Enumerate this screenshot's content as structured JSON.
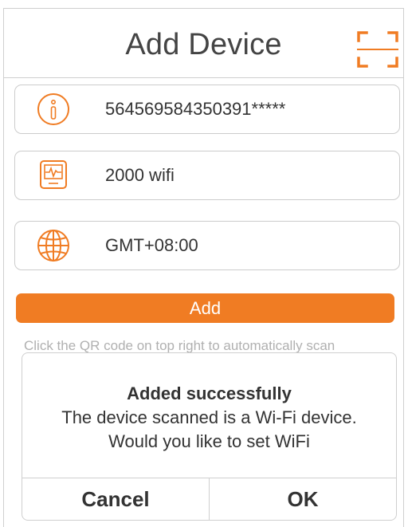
{
  "header": {
    "title": "Add Device",
    "scan_icon": "qr-scan-icon"
  },
  "fields": [
    {
      "icon": "info-icon",
      "value": "564569584350391*****"
    },
    {
      "icon": "monitor-pulse-icon",
      "value": "2000 wifi"
    },
    {
      "icon": "globe-icon",
      "value": "GMT+08:00"
    }
  ],
  "add_button": {
    "label": "Add"
  },
  "hint": "Click the QR code on top right to automatically scan",
  "dialog": {
    "title": "Added successfully",
    "line1": "The device scanned is a Wi-Fi device.",
    "line2": "Would you like to set WiFi",
    "cancel": "Cancel",
    "ok": "OK"
  },
  "colors": {
    "accent": "#f07c23",
    "border": "#cfcfcf"
  }
}
